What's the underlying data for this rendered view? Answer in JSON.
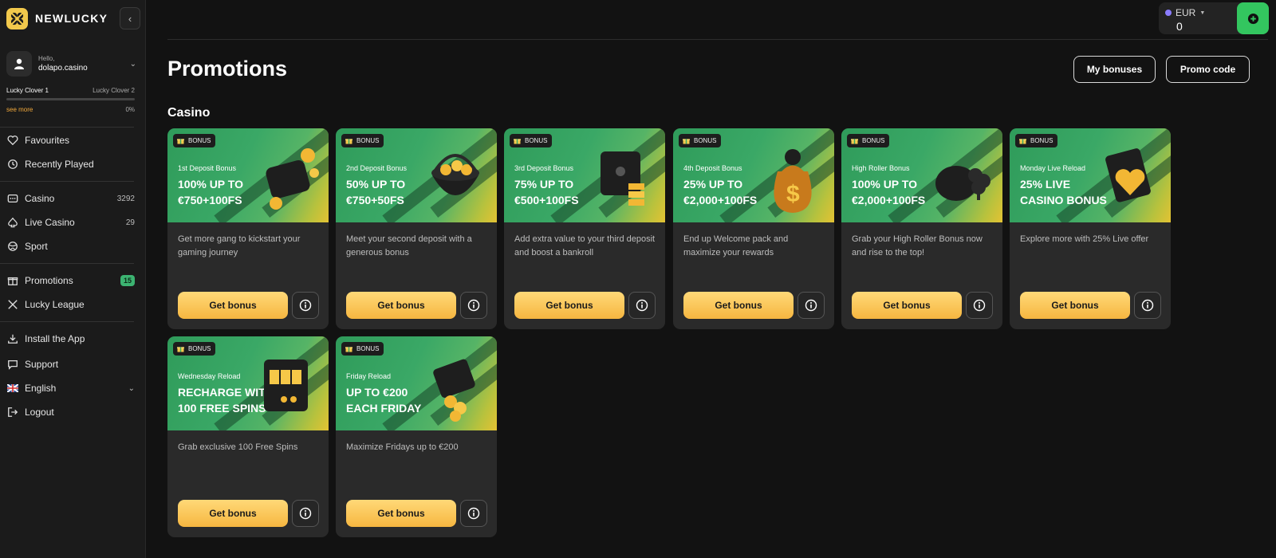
{
  "brand": {
    "name": "NEWLUCKY"
  },
  "user": {
    "hello": "Hello,",
    "username": "dolapo.casino"
  },
  "levels": {
    "current": "Lucky Clover 1",
    "next": "Lucky Clover 2",
    "see_more": "see more",
    "progress_label": "0%",
    "progress": 0
  },
  "nav": {
    "favourites": "Favourites",
    "recent": "Recently Played",
    "casino": {
      "label": "Casino",
      "count": "3292"
    },
    "live": {
      "label": "Live Casino",
      "count": "29"
    },
    "sport": "Sport",
    "promotions": {
      "label": "Promotions",
      "badge": "15"
    },
    "league": "Lucky League",
    "install": "Install the App",
    "support": "Support",
    "language": "English",
    "logout": "Logout"
  },
  "wallet": {
    "currency": "EUR",
    "balance": "0"
  },
  "page": {
    "title": "Promotions",
    "my_bonuses": "My bonuses",
    "promo_code": "Promo code",
    "section": "Casino"
  },
  "cards": [
    {
      "tag": "BONUS",
      "sub": "1st Deposit Bonus",
      "head1": "100% UP TO",
      "head2": "€750+100FS",
      "desc": "Get more gang to kickstart your gaming journey",
      "cta": "Get bonus"
    },
    {
      "tag": "BONUS",
      "sub": "2nd Deposit Bonus",
      "head1": "50% UP TO",
      "head2": "€750+50FS",
      "desc": "Meet your second deposit with a generous bonus",
      "cta": "Get bonus"
    },
    {
      "tag": "BONUS",
      "sub": "3rd Deposit Bonus",
      "head1": "75% UP TO",
      "head2": "€500+100FS",
      "desc": "Add extra value to your third deposit and boost a bankroll",
      "cta": "Get bonus"
    },
    {
      "tag": "BONUS",
      "sub": "4th Deposit Bonus",
      "head1": "25% UP TO",
      "head2": "€2,000+100FS",
      "desc": "End up Welcome pack and maximize your rewards",
      "cta": "Get bonus"
    },
    {
      "tag": "BONUS",
      "sub": "High Roller Bonus",
      "head1": "100% UP TO",
      "head2": "€2,000+100FS",
      "desc": "Grab your High Roller Bonus now and rise to the top!",
      "cta": "Get bonus"
    },
    {
      "tag": "BONUS",
      "sub": "Monday Live Reload",
      "head1": "25% LIVE",
      "head2": "CASINO BONUS",
      "desc": "Explore more with 25% Live offer",
      "cta": "Get bonus"
    },
    {
      "tag": "BONUS",
      "sub": "Wednesday Reload",
      "head1": "RECHARGE WITH",
      "head2": "100 FREE SPINS",
      "desc": "Grab exclusive 100 Free Spins",
      "cta": "Get bonus"
    },
    {
      "tag": "BONUS",
      "sub": "Friday Reload",
      "head1": "UP TO €200",
      "head2": "EACH FRIDAY",
      "desc": "Maximize Fridays up to €200",
      "cta": "Get bonus"
    }
  ],
  "colors": {
    "accent_green": "#33c65f",
    "gold": "#f6b640",
    "card_bg": "#2a2a2a",
    "page_bg": "#121212"
  }
}
